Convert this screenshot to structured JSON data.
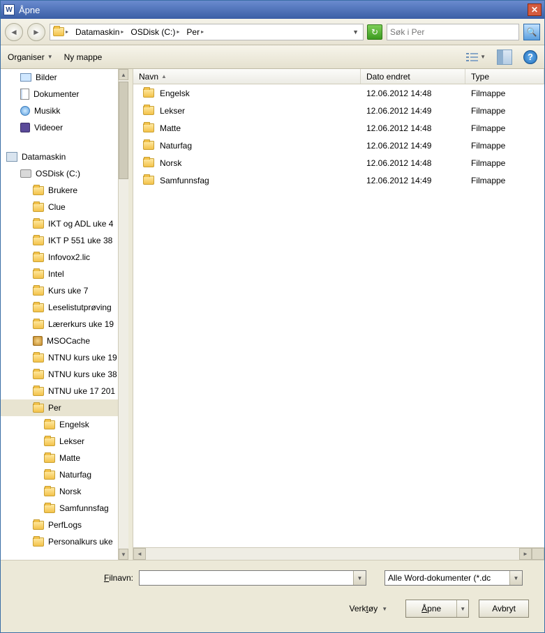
{
  "window": {
    "title": "Åpne"
  },
  "breadcrumb": {
    "items": [
      "Datamaskin",
      "OSDisk (C:)",
      "Per"
    ]
  },
  "search": {
    "placeholder": "Søk i Per"
  },
  "toolbar": {
    "organize": "Organiser",
    "new_folder": "Ny mappe"
  },
  "tree": {
    "libraries": [
      {
        "label": "Bilder",
        "icon": "ico-img"
      },
      {
        "label": "Dokumenter",
        "icon": "ico-doc"
      },
      {
        "label": "Musikk",
        "icon": "ico-note"
      },
      {
        "label": "Videoer",
        "icon": "ico-vid"
      }
    ],
    "computer": "Datamaskin",
    "disk": "OSDisk (C:)",
    "disk_children": [
      "Brukere",
      "Clue",
      "IKT og ADL uke 4",
      "IKT P 551 uke 38",
      "Infovox2.lic",
      "Intel",
      "Kurs uke 7",
      "Leselistutprøving",
      "Lærerkurs uke 19",
      "MSOCache",
      "NTNU kurs uke 19",
      "NTNU kurs uke 38",
      "NTNU uke 17 201",
      "Per",
      "PerfLogs",
      "Personalkurs uke"
    ],
    "per_children": [
      "Engelsk",
      "Lekser",
      "Matte",
      "Naturfag",
      "Norsk",
      "Samfunnsfag"
    ]
  },
  "columns": {
    "name": "Navn",
    "date": "Dato endret",
    "type": "Type"
  },
  "files": [
    {
      "name": "Engelsk",
      "date": "12.06.2012 14:48",
      "type": "Filmappe"
    },
    {
      "name": "Lekser",
      "date": "12.06.2012 14:49",
      "type": "Filmappe"
    },
    {
      "name": "Matte",
      "date": "12.06.2012 14:48",
      "type": "Filmappe"
    },
    {
      "name": "Naturfag",
      "date": "12.06.2012 14:49",
      "type": "Filmappe"
    },
    {
      "name": "Norsk",
      "date": "12.06.2012 14:48",
      "type": "Filmappe"
    },
    {
      "name": "Samfunnsfag",
      "date": "12.06.2012 14:49",
      "type": "Filmappe"
    }
  ],
  "bottom": {
    "filename_label": "Filnavn:",
    "filename_value": "",
    "filter": "Alle Word-dokumenter (*.dc",
    "tools": "Verktøy",
    "open": "Åpne",
    "cancel": "Avbryt"
  }
}
